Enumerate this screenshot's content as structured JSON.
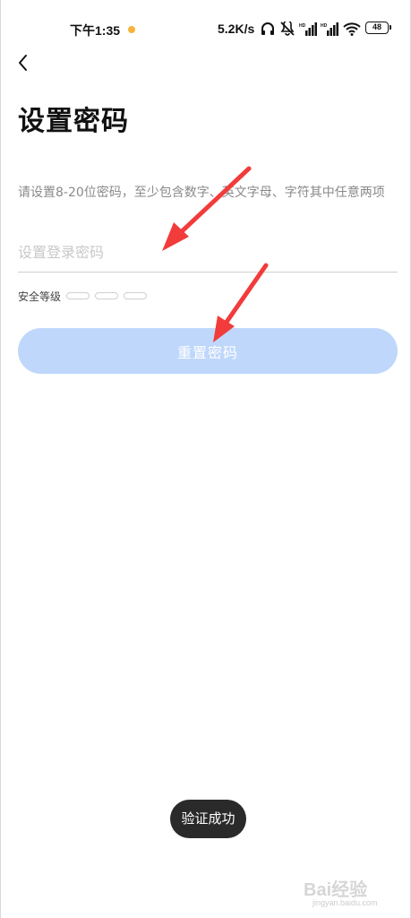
{
  "status_bar": {
    "time": "下午1:35",
    "net_speed": "5.2K/s",
    "battery": "48",
    "dot_color": "#f7b43c",
    "icons": [
      "headphone-icon",
      "mute-icon",
      "signal-icon",
      "signal-icon",
      "wifi-icon",
      "battery-icon"
    ]
  },
  "header": {
    "back_icon": "chevron-left-icon",
    "title": "设置密码"
  },
  "form": {
    "hint": "请设置8-20位密码，至少包含数字、英文字母、字符其中任意两项",
    "password_placeholder": "设置登录密码",
    "password_value": "",
    "security_label": "安全等级",
    "security_levels_filled": 0,
    "security_levels_total": 3,
    "submit_label": "重置密码",
    "submit_color": "#bfd7fb"
  },
  "toast": {
    "text": "验证成功"
  },
  "watermark": {
    "brand": "Bai经验",
    "sub": "jingyan.baidu.com"
  },
  "annotation_color": "#f23b3b"
}
